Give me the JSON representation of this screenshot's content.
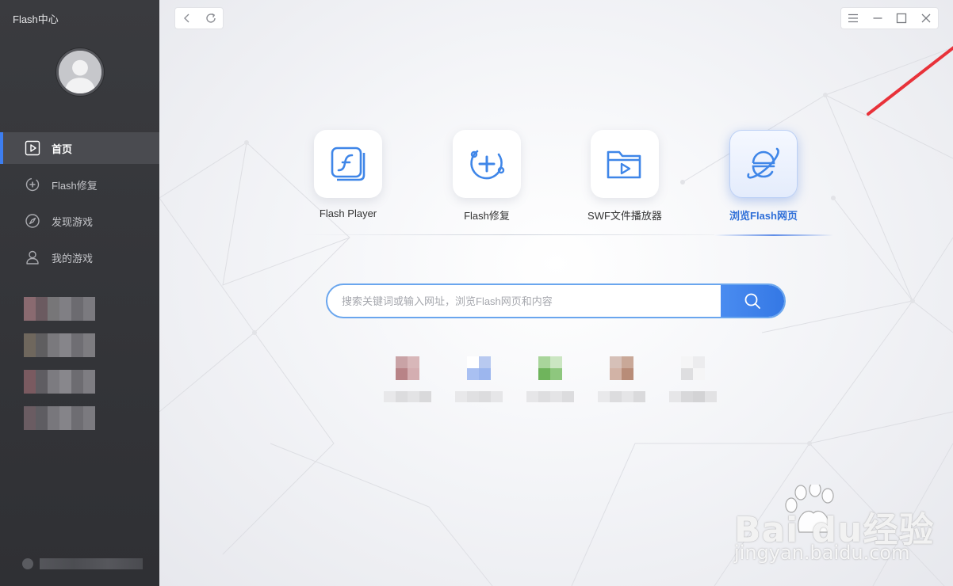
{
  "sidebar": {
    "app_title": "Flash中心",
    "items": [
      {
        "label": "首页",
        "icon": "play-square-icon",
        "active": true
      },
      {
        "label": "Flash修复",
        "icon": "repair-plus-icon",
        "active": false
      },
      {
        "label": "发现游戏",
        "icon": "compass-icon",
        "active": false
      },
      {
        "label": "我的游戏",
        "icon": "user-icon",
        "active": false
      }
    ],
    "blurred_games": [
      [
        "#8a6a70",
        "#6b5a60",
        "#777678",
        "#807f84",
        "#6c6b70",
        "#7b7a7f"
      ],
      [
        "#6f675d",
        "#5f5e60",
        "#7a797d",
        "#86858a",
        "#6f6e73",
        "#7d7c80"
      ],
      [
        "#7a5a60",
        "#5f5d62",
        "#7c7b80",
        "#88878c",
        "#6d6c71",
        "#7e7d82"
      ],
      [
        "#6a5c62",
        "#5e5d62",
        "#78777c",
        "#858489",
        "#6e6d72",
        "#7b7a7f"
      ]
    ]
  },
  "toolbar": {
    "back_icon": "chevron-left-icon",
    "refresh_icon": "refresh-icon",
    "menu_icon": "menu-icon",
    "minimize_icon": "minimize-icon",
    "maximize_icon": "maximize-icon",
    "close_icon": "close-icon"
  },
  "tiles": [
    {
      "label": "Flash Player",
      "icon": "flash-player-icon",
      "active": false
    },
    {
      "label": "Flash修复",
      "icon": "flash-repair-icon",
      "active": false
    },
    {
      "label": "SWF文件播放器",
      "icon": "swf-folder-play-icon",
      "active": false
    },
    {
      "label": "浏览Flash网页",
      "icon": "browser-e-icon",
      "active": true
    }
  ],
  "search": {
    "placeholder": "搜索关键词或输入网址，浏览Flash网页和内容",
    "value": "",
    "icon": "search-icon"
  },
  "shortcuts": [
    {
      "colors": [
        "#c9a3a6",
        "#d8b7b9",
        "#b88387",
        "#d4aeb1"
      ],
      "text": [
        "#e8e8ea",
        "#dcdcde",
        "#e3e3e5",
        "#d9d9db"
      ]
    },
    {
      "colors": [
        "#ffffff",
        "#b8c9f0",
        "#a9c0f2",
        "#9cb6ee"
      ],
      "text": [
        "#e8e8ea",
        "#e0e0e2",
        "#dcdcde",
        "#e6e6e8"
      ]
    },
    {
      "colors": [
        "#a9d59b",
        "#cbe6c2",
        "#6fb45c",
        "#8ec77e"
      ],
      "text": [
        "#e6e6e8",
        "#dedee0",
        "#e4e4e6",
        "#dcdcde"
      ]
    },
    {
      "colors": [
        "#d6c0b8",
        "#c9a898",
        "#d2b3a6",
        "#b88c78"
      ],
      "text": [
        "#e9e9eb",
        "#dcdcde",
        "#e5e5e7",
        "#dadadc"
      ]
    },
    {
      "colors": [
        "#f5f5f6",
        "#ececee",
        "#dedee0",
        "#f5f5f6"
      ],
      "text": [
        "#e6e6e8",
        "#d8d8da",
        "#d3d3d5",
        "#e2e2e4"
      ]
    }
  ],
  "watermark": {
    "brand": "Bai du经验",
    "url": "jingyan.baidu.com"
  },
  "colors": {
    "accent": "#3d7ef0",
    "annotation_arrow": "#e8323a"
  }
}
